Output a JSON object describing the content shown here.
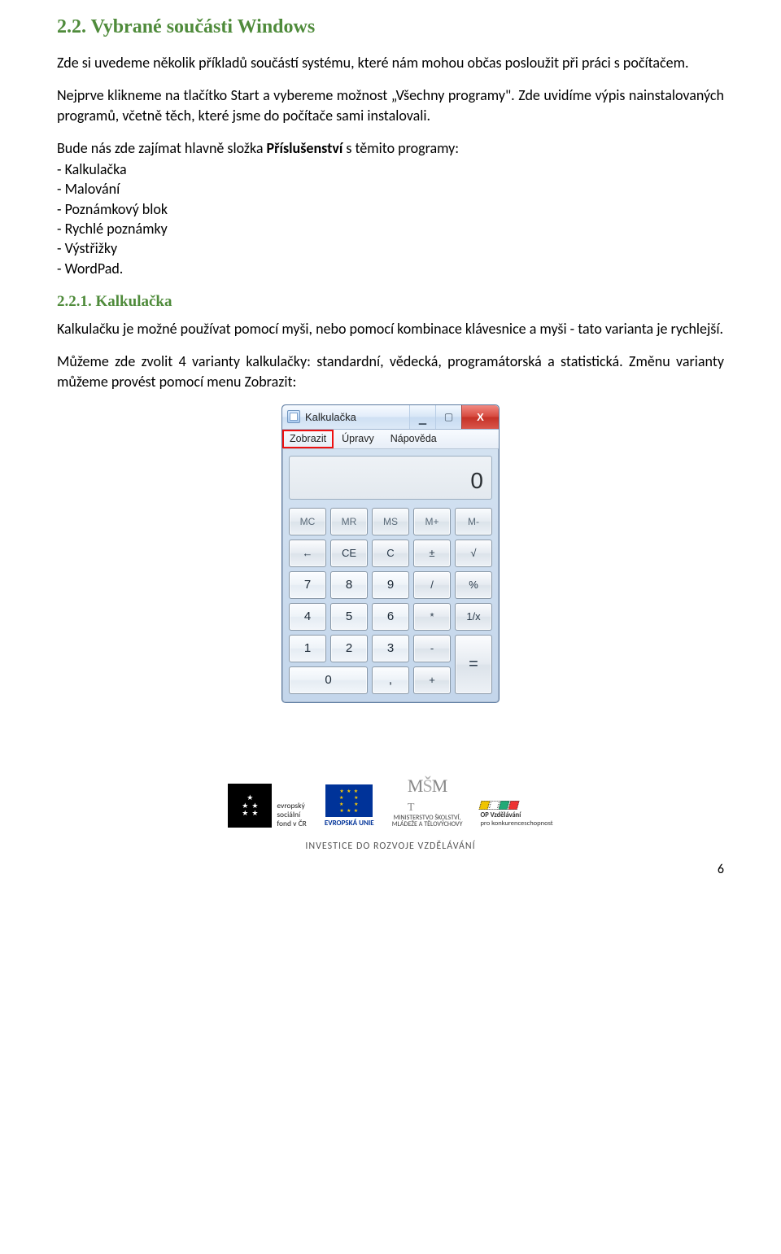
{
  "heading_2_2": "2.2. Vybrané součásti Windows",
  "para1": "Zde si uvedeme několik příkladů součástí systému, které nám mohou občas posloužit při práci s počítačem.",
  "para2": "Nejprve klikneme na tlačítko Start a vybereme možnost „Všechny programy\". Zde uvidíme výpis nainstalovaných programů, včetně těch, které jsme do počítače sami instalovali.",
  "para3_lead": "Bude nás zde zajímat hlavně složka ",
  "para3_bold": "Příslušenství",
  "para3_tail": " s těmito programy:",
  "list": [
    "- Kalkulačka",
    " - Malování",
    " - Poznámkový blok",
    " - Rychlé poznámky",
    " - Výstřižky",
    " - WordPad."
  ],
  "heading_2_2_1": "2.2.1. Kalkulačka",
  "para4": "Kalkulačku je možné používat pomocí myši, nebo pomocí kombinace klávesnice a myši - tato varianta je rychlejší.",
  "para5": "Můžeme zde zvolit 4 varianty kalkulačky: standardní, vědecká, programátorská a statistická. Změnu varianty můžeme provést pomocí menu Zobrazit:",
  "calc": {
    "title": "Kalkulačka",
    "menu": [
      "Zobrazit",
      "Úpravy",
      "Nápověda"
    ],
    "display": "0",
    "win": {
      "min": "▁",
      "max": "▢",
      "close": "X"
    },
    "mem": [
      "MC",
      "MR",
      "MS",
      "M+",
      "M-"
    ],
    "row2": [
      "←",
      "CE",
      "C",
      "±",
      "√"
    ],
    "row3": [
      "7",
      "8",
      "9",
      "/",
      "%"
    ],
    "row4": [
      "4",
      "5",
      "6",
      "*",
      "1/x"
    ],
    "row5": [
      "1",
      "2",
      "3",
      "-",
      "="
    ],
    "row6": [
      "0",
      ",",
      "+"
    ]
  },
  "footer": {
    "esf_lines": "evropský\nsociální\nfond v ČR",
    "eu_label": "EVROPSKÁ UNIE",
    "msmt_top": "MŠMT",
    "msmt_lines": "MINISTERSTVO ŠKOLSTVÍ,\nMLÁDEŽE A TĚLOVÝCHOVY",
    "opvk_line1": "OP Vzdělávání",
    "opvk_line2": "pro konkurenceschopnost",
    "sub": "INVESTICE DO ROZVOJE VZDĚLÁVÁNÍ"
  },
  "page_number": "6"
}
